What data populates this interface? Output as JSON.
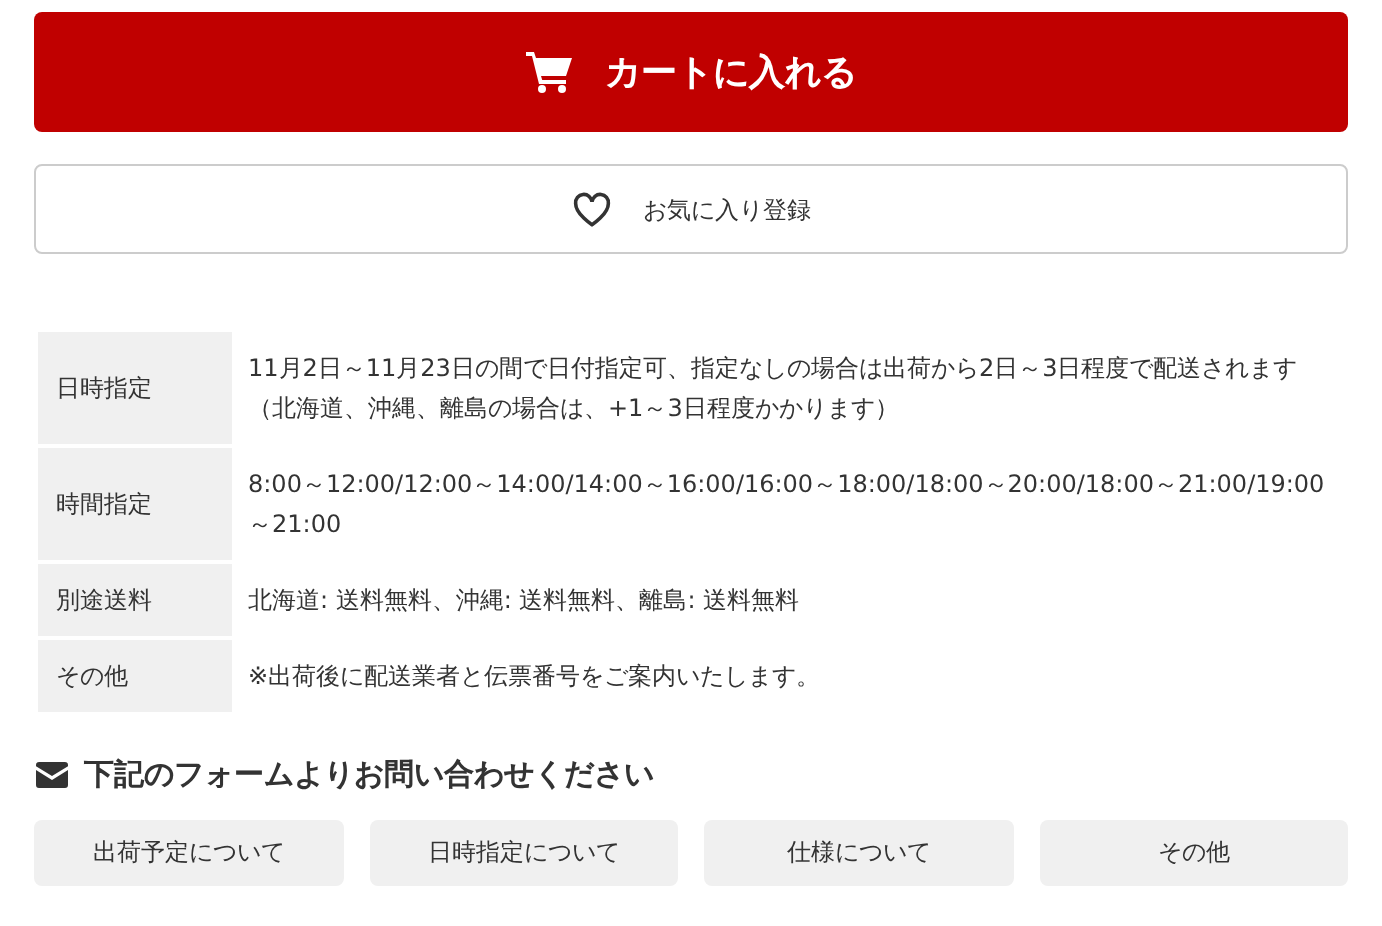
{
  "cart_button": {
    "label": "カートに入れる"
  },
  "favorite_button": {
    "label": "お気に入り登録"
  },
  "info_table": {
    "rows": [
      {
        "label": "日時指定",
        "lines": [
          "11月2日～11月23日の間で日付指定可、指定なしの場合は出荷から2日～3日程度で配送されます",
          "（北海道、沖縄、離島の場合は、+1～3日程度かかります）"
        ]
      },
      {
        "label": "時間指定",
        "lines": [
          "8:00～12:00/12:00～14:00/14:00～16:00/16:00～18:00/18:00～20:00/18:00～21:00/19:00～21:00"
        ]
      },
      {
        "label": "別途送料",
        "lines": [
          "北海道: 送料無料、沖縄: 送料無料、離島: 送料無料"
        ]
      },
      {
        "label": "その他",
        "lines": [
          "※出荷後に配送業者と伝票番号をご案内いたします。"
        ]
      }
    ]
  },
  "contact": {
    "heading": "下記のフォームよりお問い合わせください",
    "buttons": [
      "出荷予定について",
      "日時指定について",
      "仕様について",
      "その他"
    ]
  }
}
